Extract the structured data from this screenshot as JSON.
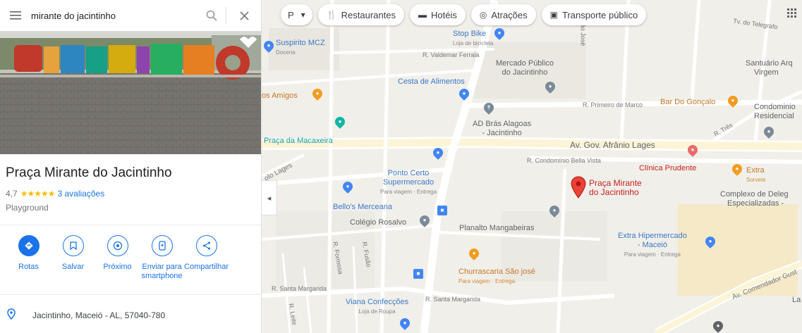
{
  "search": {
    "value": "mirante do jacintinho"
  },
  "place": {
    "title": "Praça Mirante do Jacintinho",
    "rating": "4,7",
    "stars": "★★★★★",
    "reviews": "3 avaliações",
    "category": "Playground",
    "address": "Jacintinho, Maceió - AL, 57040-780"
  },
  "actions": [
    {
      "label": "Rotas",
      "icon": "directions-icon"
    },
    {
      "label": "Salvar",
      "icon": "bookmark-icon"
    },
    {
      "label": "Próximo",
      "icon": "nearby-icon"
    },
    {
      "label": "Enviar para smartphone",
      "icon": "send-to-phone-icon"
    },
    {
      "label": "Compartilhar",
      "icon": "share-icon"
    }
  ],
  "chips": {
    "layer": "P",
    "restaurants": "Restaurantes",
    "hotels": "Hotéis",
    "attractions": "Atrações",
    "transit": "Transporte público"
  },
  "map_labels": {
    "stop_bike": "Stop Bike",
    "stop_bike_sub": "Loja de bicicleta",
    "suspirito": "Suspirito MCZ",
    "suspirito_sub": "Doceria",
    "valdemar": "R. Valdemar Ferraia",
    "mercado": "Mercado Público",
    "mercado2": "do Jacintinho",
    "santuario": "Santuário Arq",
    "santuario2": "Virgem",
    "cesta": "Cesta de Alimentos",
    "amigos": "os Amigos",
    "primeiro_marco": "R. Primeiro de Marco",
    "bar_goncalo": "Bar Do Gonçalo",
    "condominio": "Condominio",
    "condominio2": "Residencial",
    "ad_bras": "AD Brás Alagoas",
    "ad_bras2": "- Jacintinho",
    "praca_macaxeira": "Praça da Macaxeira",
    "av_gov": "Av. Gov. Afrânio Lages",
    "bella_vista": "R. Condomínio Bella Vista",
    "clinica": "Clínica Prudente",
    "extra_sorvete": "Extra",
    "extra_sorvete_sub": "Sorvete",
    "ponto_certo": "Ponto Certo",
    "ponto_certo2": "Supermercado",
    "ponto_certo_sub": "Para viagem · Entrega",
    "praca_mirante": "Praça Mirante",
    "praca_mirante2": "do Jacintinho",
    "complexo": "Complexo de Deleg",
    "complexo2": "Especializadas -",
    "bellos": "Bello's Merceana",
    "colegio": "Colégio Rosalvo",
    "planalto": "Planalto Mangabeiras",
    "extra_hiper": "Extra Hipermercado",
    "extra_hiper2": "- Maceió",
    "extra_hiper_sub": "Para viagem · Entrega",
    "churrascaria": "Churrascaria São josé",
    "churrascaria_sub": "Para viagem · Entrega",
    "santa_margarida": "R. Santa Margarida",
    "santa_margarida2": "R. Santa Margarida",
    "viana": "Viana Confecções",
    "viana_sub": "Loja de Roupa",
    "comendador": "Av. Comendador Gust",
    "telegrafo": "Tv. do Telegrafo",
    "lages": "olo Lages",
    "la": "La",
    "tres": "R. Três",
    "formosa": "R. Formosa",
    "fusao": "R. Fusão",
    "leite": "R. Leite",
    "sao_jose": "São José"
  },
  "colors": {
    "accent": "#1a73e8",
    "pin": "#ea4335"
  }
}
